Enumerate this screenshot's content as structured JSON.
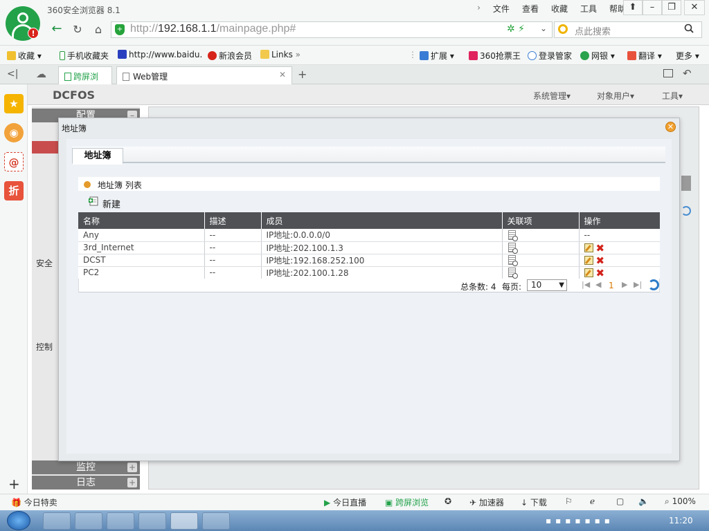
{
  "browser": {
    "app_title": "360安全浏览器 8.1",
    "avatar_badge": "!",
    "menu": [
      "文件",
      "查看",
      "收藏",
      "工具",
      "帮助"
    ],
    "url_scheme": "http://",
    "url_host": "192.168.1.1",
    "url_path": "/mainpage.php#",
    "search_placeholder": "点此搜索",
    "bookmarks": [
      "收藏",
      "手机收藏夹",
      "http://www.baidu.",
      "新浪会员",
      "Links",
      "扩展",
      "360抢票王",
      "登录管家",
      "网银",
      "翻译",
      "更多"
    ],
    "tabs": [
      "跨屏浏览",
      "Web管理"
    ],
    "new_tab_label": "+"
  },
  "sidebar_icons": [
    "star-icon",
    "weibo-icon",
    "mail-icon",
    "discount-icon"
  ],
  "sidebar_discount_label": "折",
  "app": {
    "logo": "DCFOS",
    "top_menu": [
      "系统管理",
      "对象用户",
      "工具"
    ],
    "left_nav": {
      "section_top": "配置",
      "group_security": "安全",
      "group_control": "控制",
      "section_monitor": "监控",
      "section_log": "日志"
    }
  },
  "dialog": {
    "title": "地址簿",
    "tab_label": "地址簿",
    "list_title": "地址簿 列表",
    "new_label": "新建",
    "columns": [
      "名称",
      "描述",
      "成员",
      "关联项",
      "操作"
    ],
    "rows": [
      {
        "name": "Any",
        "desc": "--",
        "member": "IP地址:0.0.0.0/0",
        "actions": "--"
      },
      {
        "name": "3rd_Internet",
        "desc": "--",
        "member": "IP地址:202.100.1.3",
        "actions": "edit-delete"
      },
      {
        "name": "DCST",
        "desc": "--",
        "member": "IP地址:192.168.252.100",
        "actions": "edit-delete"
      },
      {
        "name": "PC2",
        "desc": "--",
        "member": "IP地址:202.100.1.28",
        "actions": "edit-delete"
      }
    ],
    "pager": {
      "total_label": "总条数: 4",
      "per_page_label": "每页:",
      "per_page_value": "10",
      "current_page": "1"
    }
  },
  "statusbar": {
    "left": "今日特卖",
    "items": [
      "今日直播",
      "跨屏浏览",
      "加速器",
      "下载"
    ],
    "zoom": "100%"
  },
  "taskbar": {
    "clock": "11:20"
  },
  "colors": {
    "brand_green": "#23a24a",
    "grid_header": "#4f5155",
    "list_dot": "#e49b2b",
    "delete_red": "#d2231b"
  }
}
